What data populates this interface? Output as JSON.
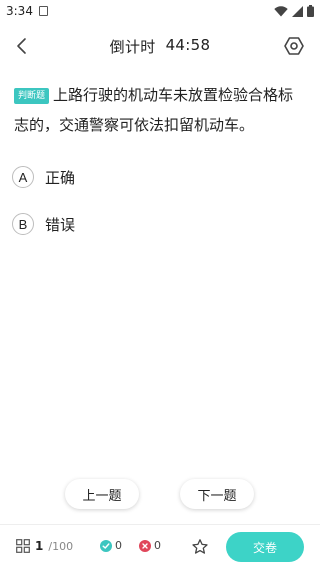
{
  "status_bar": {
    "time": "3:34"
  },
  "header": {
    "timer_label": "倒计时",
    "timer_value": "44:58"
  },
  "question": {
    "type_tag": "判断题",
    "text": "上路行驶的机动车未放置检验合格标志的，交通警察可依法扣留机动车。"
  },
  "options": [
    {
      "letter": "A",
      "text": "正确"
    },
    {
      "letter": "B",
      "text": "错误"
    }
  ],
  "nav": {
    "prev_label": "上一题",
    "next_label": "下一题"
  },
  "bottom": {
    "current": "1",
    "total": "/100",
    "correct_count": "0",
    "wrong_count": "0",
    "submit_label": "交卷"
  },
  "colors": {
    "accent": "#3dd3c7",
    "tag": "#3cc6c0",
    "correct": "#3cc6c0",
    "wrong": "#e0465a"
  }
}
